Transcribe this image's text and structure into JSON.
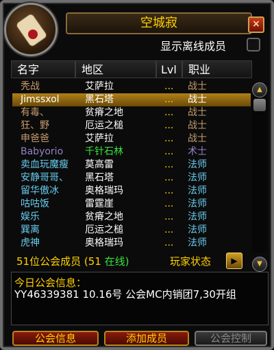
{
  "window": {
    "title": "空城寂",
    "close_glyph": "×"
  },
  "options": {
    "show_offline_label": "显示离线成员",
    "show_offline_checked": false
  },
  "columns": {
    "name": "名字",
    "zone": "地区",
    "level": "Lvl",
    "class": "职业"
  },
  "members": [
    {
      "name": "秃战",
      "zone": "艾萨拉",
      "level": "...",
      "class": "战士",
      "name_color": "#c79c6e",
      "class_color": "#c79c6e",
      "zone_color": "#ffffff",
      "selected": false
    },
    {
      "name": "Jimssxol",
      "zone": "黑石塔",
      "level": "...",
      "class": "战士",
      "name_color": "#ffffff",
      "class_color": "#ffffff",
      "zone_color": "#ffffff",
      "selected": true
    },
    {
      "name": "有毒、",
      "zone": "贫瘠之地",
      "level": "...",
      "class": "战士",
      "name_color": "#c79c6e",
      "class_color": "#c79c6e",
      "zone_color": "#ffffff",
      "selected": false
    },
    {
      "name": "狂、野",
      "zone": "厄运之槌",
      "level": "...",
      "class": "战士",
      "name_color": "#c79c6e",
      "class_color": "#c79c6e",
      "zone_color": "#ffffff",
      "selected": false
    },
    {
      "name": "申爸爸",
      "zone": "艾萨拉",
      "level": "...",
      "class": "战士",
      "name_color": "#c79c6e",
      "class_color": "#c79c6e",
      "zone_color": "#ffffff",
      "selected": false
    },
    {
      "name": "Babyorio",
      "zone": "千针石林",
      "level": "...",
      "class": "术士",
      "name_color": "#9482c9",
      "class_color": "#9482c9",
      "zone_color": "#39e43c",
      "selected": false
    },
    {
      "name": "卖血玩魔瘦",
      "zone": "莫高雷",
      "level": "...",
      "class": "法师",
      "name_color": "#69ccf0",
      "class_color": "#69ccf0",
      "zone_color": "#ffffff",
      "selected": false
    },
    {
      "name": "安静哥哥、",
      "zone": "黑石塔",
      "level": "...",
      "class": "法师",
      "name_color": "#69ccf0",
      "class_color": "#69ccf0",
      "zone_color": "#ffffff",
      "selected": false
    },
    {
      "name": "留华傲冰",
      "zone": "奥格瑞玛",
      "level": "...",
      "class": "法师",
      "name_color": "#69ccf0",
      "class_color": "#69ccf0",
      "zone_color": "#ffffff",
      "selected": false
    },
    {
      "name": "咕咕饭",
      "zone": "雷霆崖",
      "level": "...",
      "class": "法师",
      "name_color": "#69ccf0",
      "class_color": "#69ccf0",
      "zone_color": "#ffffff",
      "selected": false
    },
    {
      "name": "娱乐",
      "zone": "贫瘠之地",
      "level": "...",
      "class": "法师",
      "name_color": "#69ccf0",
      "class_color": "#69ccf0",
      "zone_color": "#ffffff",
      "selected": false
    },
    {
      "name": "巽离",
      "zone": "厄运之槌",
      "level": "...",
      "class": "法师",
      "name_color": "#69ccf0",
      "class_color": "#69ccf0",
      "zone_color": "#ffffff",
      "selected": false
    },
    {
      "name": "虎神",
      "zone": "奥格瑞玛",
      "level": "...",
      "class": "法师",
      "name_color": "#69ccf0",
      "class_color": "#69ccf0",
      "zone_color": "#ffffff",
      "selected": false
    }
  ],
  "summary": {
    "members_text": "51位公会成员 (51 ",
    "online_text": "在线)",
    "player_status_label": "玩家状态"
  },
  "motd": {
    "title": "今日公会信息：",
    "text": "YY46339381 10.16号 公会MC内销团7,30开组"
  },
  "buttons": {
    "guild_info": "公会信息",
    "add_member": "添加成员",
    "guild_control": "公会控制"
  },
  "colors": {
    "accent_gold": "#ffd200",
    "online_green": "#39e43c",
    "button_red": "#8a1a0a"
  }
}
